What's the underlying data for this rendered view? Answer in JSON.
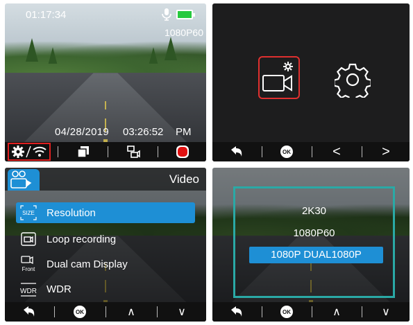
{
  "panel1": {
    "time": "01:17:34",
    "resolution": "1080P60",
    "date": "04/28/2019",
    "clock": "03:26:52",
    "ampm": "PM",
    "toolbar": [
      "settings-wifi-icon",
      "copy-icon",
      "switch-camera-icon",
      "record-icon"
    ]
  },
  "panel2": {
    "toolbar": [
      "back-icon",
      "OK",
      "<",
      ">"
    ],
    "icons": [
      "video-settings-icon",
      "gear-icon"
    ]
  },
  "panel3": {
    "header_title": "Video",
    "items": [
      {
        "icon_text": "SIZE",
        "label": "Resolution"
      },
      {
        "icon_text": "",
        "label": "Loop recording"
      },
      {
        "icon_text": "Front",
        "label": "Dual cam Display"
      },
      {
        "icon_text": "WDR",
        "label": "WDR"
      }
    ],
    "toolbar": [
      "back-icon",
      "OK",
      "∧",
      "∨"
    ]
  },
  "panel4": {
    "options": [
      "2K30",
      "1080P60",
      "1080P DUAL1080P"
    ],
    "selected_index": 2,
    "toolbar": [
      "back-icon",
      "OK",
      "∧",
      "∨"
    ]
  },
  "colors": {
    "accent": "#1e8fd5",
    "highlight_red": "#e0302f",
    "popup_border": "#2aa9a6",
    "battery": "#27c93f"
  }
}
